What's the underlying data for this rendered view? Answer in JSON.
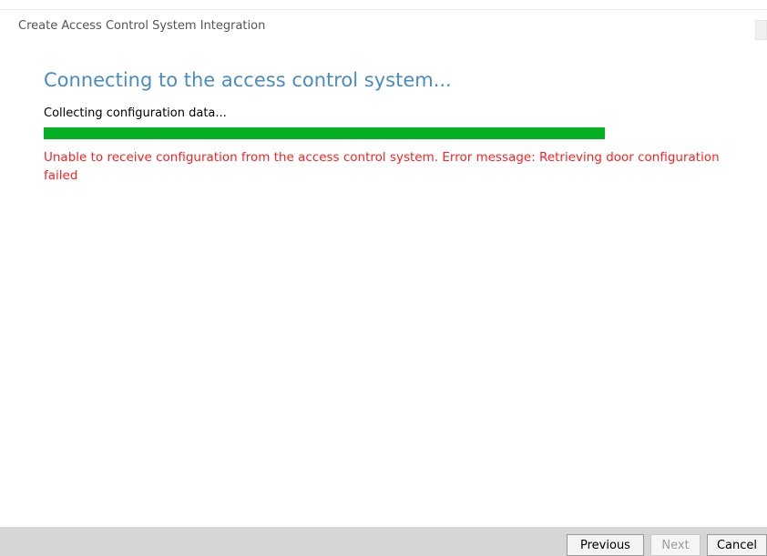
{
  "window": {
    "title": "Create Access Control System Integration"
  },
  "main": {
    "heading": "Connecting to the access control system...",
    "status": "Collecting configuration data...",
    "progress_percent": 100,
    "progress_color": "#06b025",
    "error_message": "Unable to receive configuration from the access control system. Error message: Retrieving door configuration failed",
    "error_color": "#ff2020",
    "heading_color": "#4a8cc2"
  },
  "footer": {
    "previous_label": "Previous",
    "next_label": "Next",
    "next_enabled": false,
    "cancel_label": "Cancel"
  }
}
